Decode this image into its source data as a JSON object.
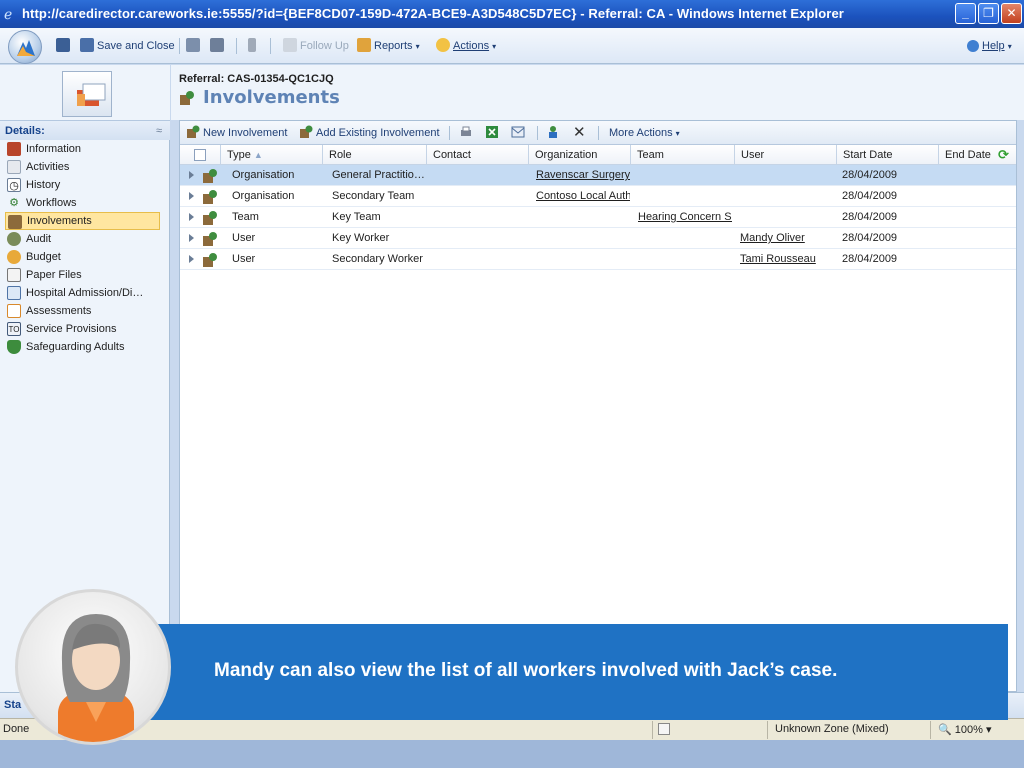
{
  "window": {
    "title": "http://caredirector.careworks.ie:5555/?id={BEF8CD07-159D-472A-BCE9-A3D548C5D7EC} - Referral: CA - Windows Internet Explorer"
  },
  "toolbar": {
    "save_close": "Save and Close",
    "follow_up": "Follow Up",
    "reports": "Reports",
    "actions": "Actions",
    "help": "Help"
  },
  "left_nav": {
    "heading": "Details:",
    "items": [
      {
        "label": "Information",
        "icon": "information-icon"
      },
      {
        "label": "Activities",
        "icon": "activities-icon"
      },
      {
        "label": "History",
        "icon": "history-icon"
      },
      {
        "label": "Workflows",
        "icon": "workflows-icon"
      },
      {
        "label": "Involvements",
        "icon": "involvements-icon"
      },
      {
        "label": "Audit",
        "icon": "audit-icon"
      },
      {
        "label": "Budget",
        "icon": "budget-icon"
      },
      {
        "label": "Paper Files",
        "icon": "paper-files-icon"
      },
      {
        "label": "Hospital Admission/Di…",
        "icon": "hospital-icon"
      },
      {
        "label": "Assessments",
        "icon": "assessments-icon"
      },
      {
        "label": "Service Provisions",
        "icon": "service-provisions-icon"
      },
      {
        "label": "Safeguarding Adults",
        "icon": "safeguarding-icon"
      }
    ],
    "selected": "Involvements"
  },
  "header": {
    "record": "Referral: CAS-01354-QC1CJQ",
    "entity": "Involvements"
  },
  "grid_toolbar": {
    "new_involvement": "New Involvement",
    "add_existing": "Add Existing Involvement",
    "more_actions": "More Actions"
  },
  "grid": {
    "columns": [
      "Type",
      "Role",
      "Contact",
      "Organization",
      "Team",
      "User",
      "Start Date",
      "End Date"
    ],
    "rows": [
      {
        "type": "Organisation",
        "role": "General Practitio…",
        "contact": "",
        "organization": "Ravenscar Surgery",
        "team": "",
        "user": "",
        "start": "28/04/2009",
        "end": ""
      },
      {
        "type": "Organisation",
        "role": "Secondary Team",
        "contact": "",
        "organization": "Contoso Local Auth",
        "team": "",
        "user": "",
        "start": "28/04/2009",
        "end": ""
      },
      {
        "type": "Team",
        "role": "Key Team",
        "contact": "",
        "organization": "",
        "team": "Hearing Concern Su",
        "user": "",
        "start": "28/04/2009",
        "end": ""
      },
      {
        "type": "User",
        "role": "Key Worker",
        "contact": "",
        "organization": "",
        "team": "",
        "user": "Mandy Oliver",
        "start": "28/04/2009",
        "end": ""
      },
      {
        "type": "User",
        "role": "Secondary Worker",
        "contact": "",
        "organization": "",
        "team": "",
        "user": "Tami Rousseau",
        "start": "28/04/2009",
        "end": ""
      }
    ]
  },
  "status": {
    "label": "Sta",
    "done": "Done",
    "zone": "Unknown Zone (Mixed)",
    "zoom": "100%"
  },
  "overlay": {
    "caption": "Mandy can also view the list of all workers involved with Jack’s case."
  },
  "colors": {
    "accent": "#1f72c4",
    "selected_nav": "#ffe6a0",
    "selected_row": "#c5dbf3"
  }
}
